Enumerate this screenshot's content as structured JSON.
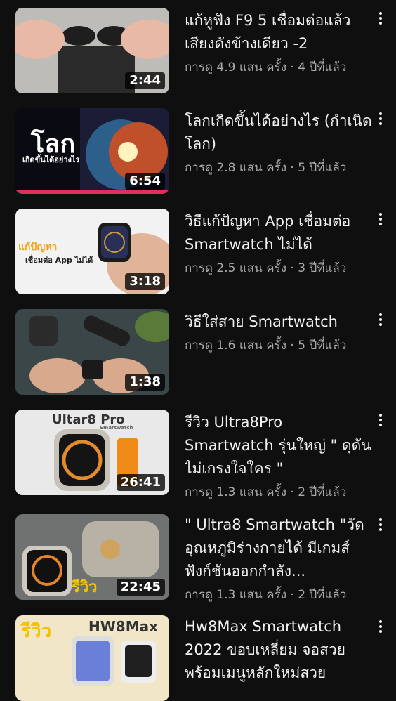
{
  "videos": [
    {
      "title": "แก้หูฟัง F9 5 เชื่อมต่อแล้วเสียงดังข้างเดียว -2",
      "meta": "การดู 4.9 แสน ครั้ง · 4 ปีที่แล้ว",
      "duration": "2:44"
    },
    {
      "title": "โลกเกิดขึ้นได้อย่างไร (กำเนิดโลก)",
      "meta": "การดู 2.8 แสน ครั้ง · 5 ปีที่แล้ว",
      "duration": "6:54",
      "thumb_big": "โลก",
      "thumb_small": "เกิดขึ้นได้อย่างไร"
    },
    {
      "title": "วิธีแก้ปัญหา App เชื่อมต่อ Smartwatch ไม่ได้",
      "meta": "การดู 2.5 แสน ครั้ง · 3 ปีที่แล้ว",
      "duration": "3:18",
      "thumb_big": "แก้ปัญหา",
      "thumb_small": "เชื่อมต่อ App ไม่ได้"
    },
    {
      "title": "วิธีใส่สาย Smartwatch",
      "meta": "การดู 1.6 แสน ครั้ง · 5 ปีที่แล้ว",
      "duration": "1:38"
    },
    {
      "title": "รีวิว Ultra8Pro Smartwatch รุ่นใหญ่ \" ดุดันไม่เกรงใจใคร \"",
      "meta": "การดู 1.3 แสน ครั้ง · 2 ปีที่แล้ว",
      "duration": "26:41",
      "thumb_big": "Ultar8 Pro",
      "thumb_small": "Smartwatch"
    },
    {
      "title": "\" Ultra8 Smartwatch \"วัดอุณหภูมิร่างกายได้ มีเกมส์ ฟังก์ชันออกกำลัง...",
      "meta": "การดู 1.3 แสน ครั้ง · 2 ปีที่แล้ว",
      "duration": "22:45",
      "thumb_big": "รีวิว"
    },
    {
      "title": "Hw8Max Smartwatch 2022 ขอบเหลี่ยม จอสวย พร้อมเมนูหลักใหม่สวย",
      "meta": "",
      "duration": "",
      "thumb_big": "รีวิว",
      "thumb_small": "HW8Max"
    }
  ]
}
